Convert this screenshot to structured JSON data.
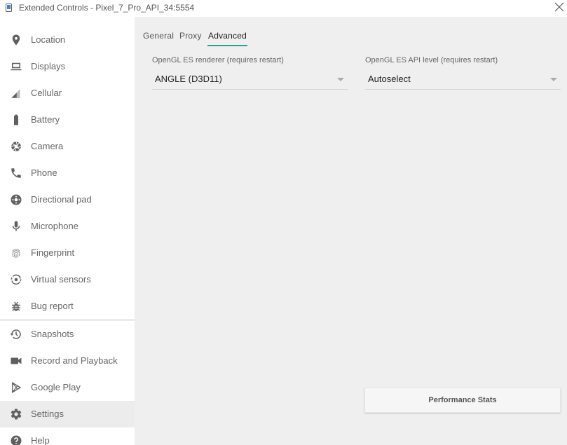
{
  "window": {
    "title": "Extended Controls - Pixel_7_Pro_API_34:5554"
  },
  "sidebar": {
    "items": [
      {
        "label": "Location",
        "icon": "location-pin-icon"
      },
      {
        "label": "Displays",
        "icon": "display-icon"
      },
      {
        "label": "Cellular",
        "icon": "cellular-signal-icon"
      },
      {
        "label": "Battery",
        "icon": "battery-icon"
      },
      {
        "label": "Camera",
        "icon": "camera-shutter-icon"
      },
      {
        "label": "Phone",
        "icon": "phone-icon"
      },
      {
        "label": "Directional pad",
        "icon": "dpad-icon"
      },
      {
        "label": "Microphone",
        "icon": "microphone-icon"
      },
      {
        "label": "Fingerprint",
        "icon": "fingerprint-icon"
      },
      {
        "label": "Virtual sensors",
        "icon": "rotation-icon"
      },
      {
        "label": "Bug report",
        "icon": "bug-icon"
      },
      {
        "label": "Snapshots",
        "icon": "history-icon"
      },
      {
        "label": "Record and Playback",
        "icon": "video-camera-icon"
      },
      {
        "label": "Google Play",
        "icon": "google-play-icon"
      },
      {
        "label": "Settings",
        "icon": "gear-icon"
      },
      {
        "label": "Help",
        "icon": "help-icon"
      }
    ],
    "active_item": "Settings"
  },
  "tabs": [
    {
      "label": "General"
    },
    {
      "label": "Proxy"
    },
    {
      "label": "Advanced"
    }
  ],
  "active_tab": "Advanced",
  "renderer": {
    "label": "OpenGL ES renderer (requires restart)",
    "value": "ANGLE (D3D11)"
  },
  "api_level": {
    "label": "OpenGL ES API level (requires restart)",
    "value": "Autoselect"
  },
  "performance_button": "Performance Stats",
  "colors": {
    "accent": "#22a590",
    "sidebar_bg": "#ffffff",
    "content_bg": "#efefef",
    "icon": "#5f5f5f"
  }
}
